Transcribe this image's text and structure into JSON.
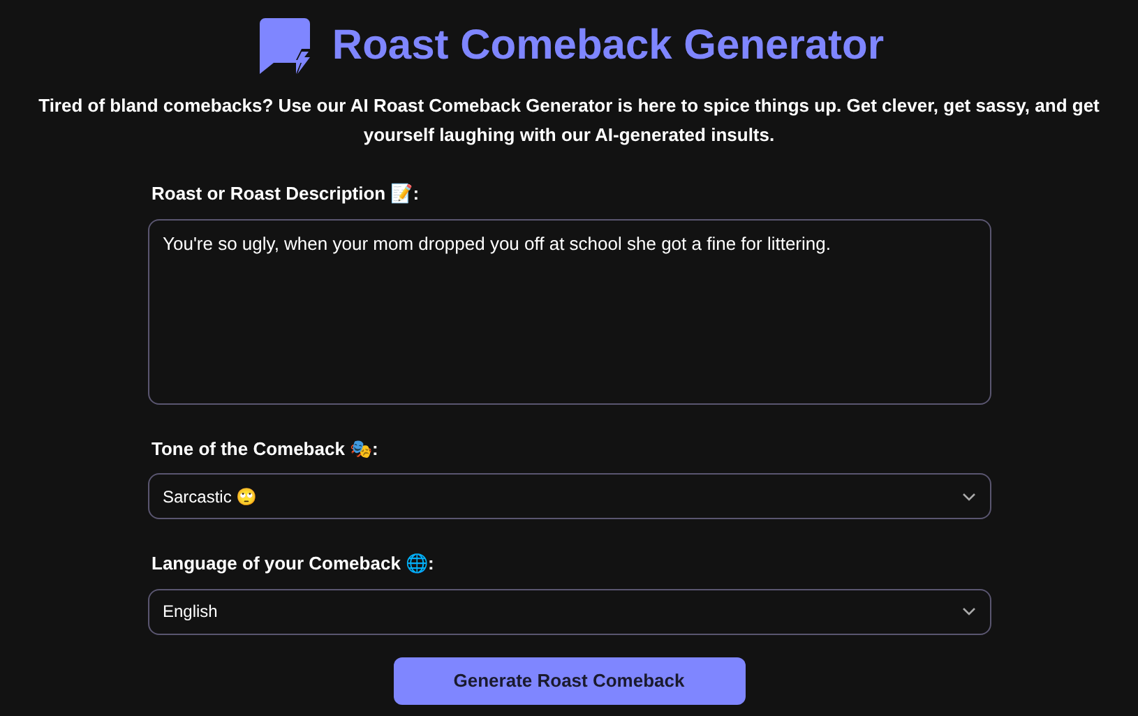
{
  "header": {
    "title": "Roast Comeback Generator"
  },
  "intro": "Tired of bland comebacks? Use our AI Roast Comeback Generator is here to spice things up. Get clever, get sassy, and get yourself laughing with our AI-generated insults.",
  "fields": [
    {
      "kind": "textarea",
      "label": "Roast or Roast Description 📝:",
      "value": "You're so ugly, when your mom dropped you off at school she got a fine for littering."
    },
    {
      "kind": "select",
      "label": "Tone of the Comeback 🎭:",
      "value": "Sarcastic 🙄"
    },
    {
      "kind": "select",
      "label": "Language of your Comeback 🌐:",
      "value": "English"
    }
  ],
  "submit": "Generate Roast Comeback"
}
